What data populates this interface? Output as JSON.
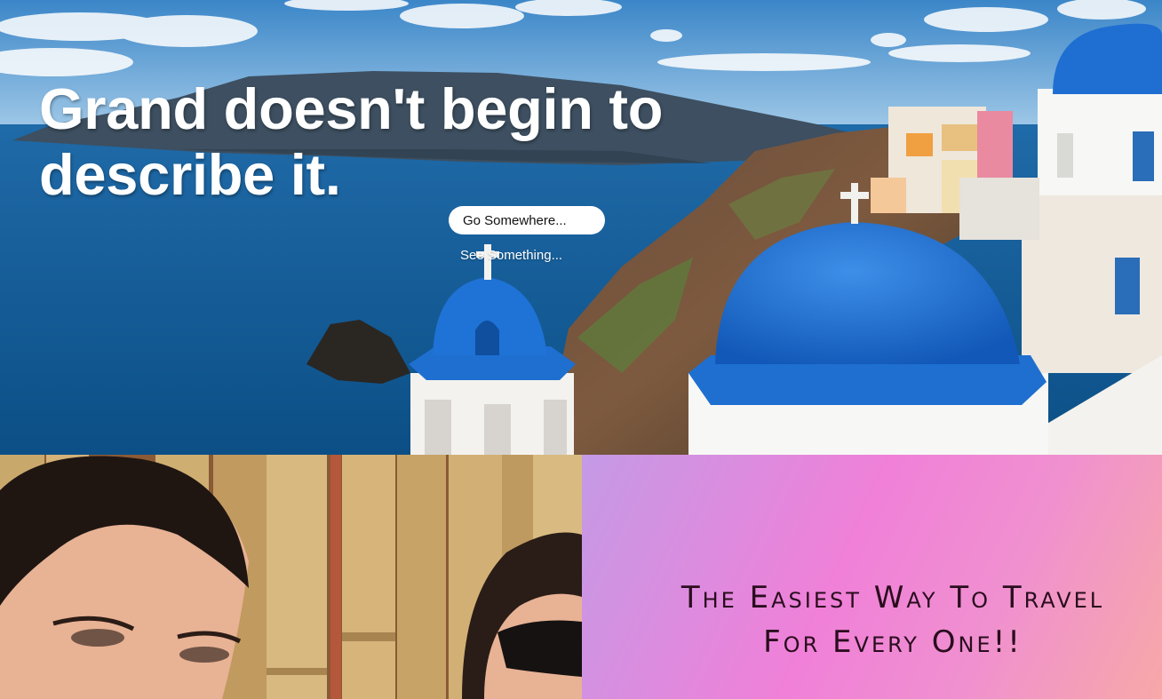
{
  "hero": {
    "title": "Grand doesn't begin to describe it.",
    "primary_button": "Go Somewhere...",
    "secondary_link": "See Something...",
    "image": "santorini-blue-domes-photo"
  },
  "feature": {
    "image": "smiling-friends-photo",
    "tagline": "The Easiest Way To Travel For Every One!!"
  },
  "colors": {
    "dome_blue": "#1e6fd0",
    "sea_blue": "#0f5a9a",
    "panel_pink": "#f080d8",
    "panel_lavender": "#c49ae6",
    "tagline_text": "#2a0d1e"
  }
}
